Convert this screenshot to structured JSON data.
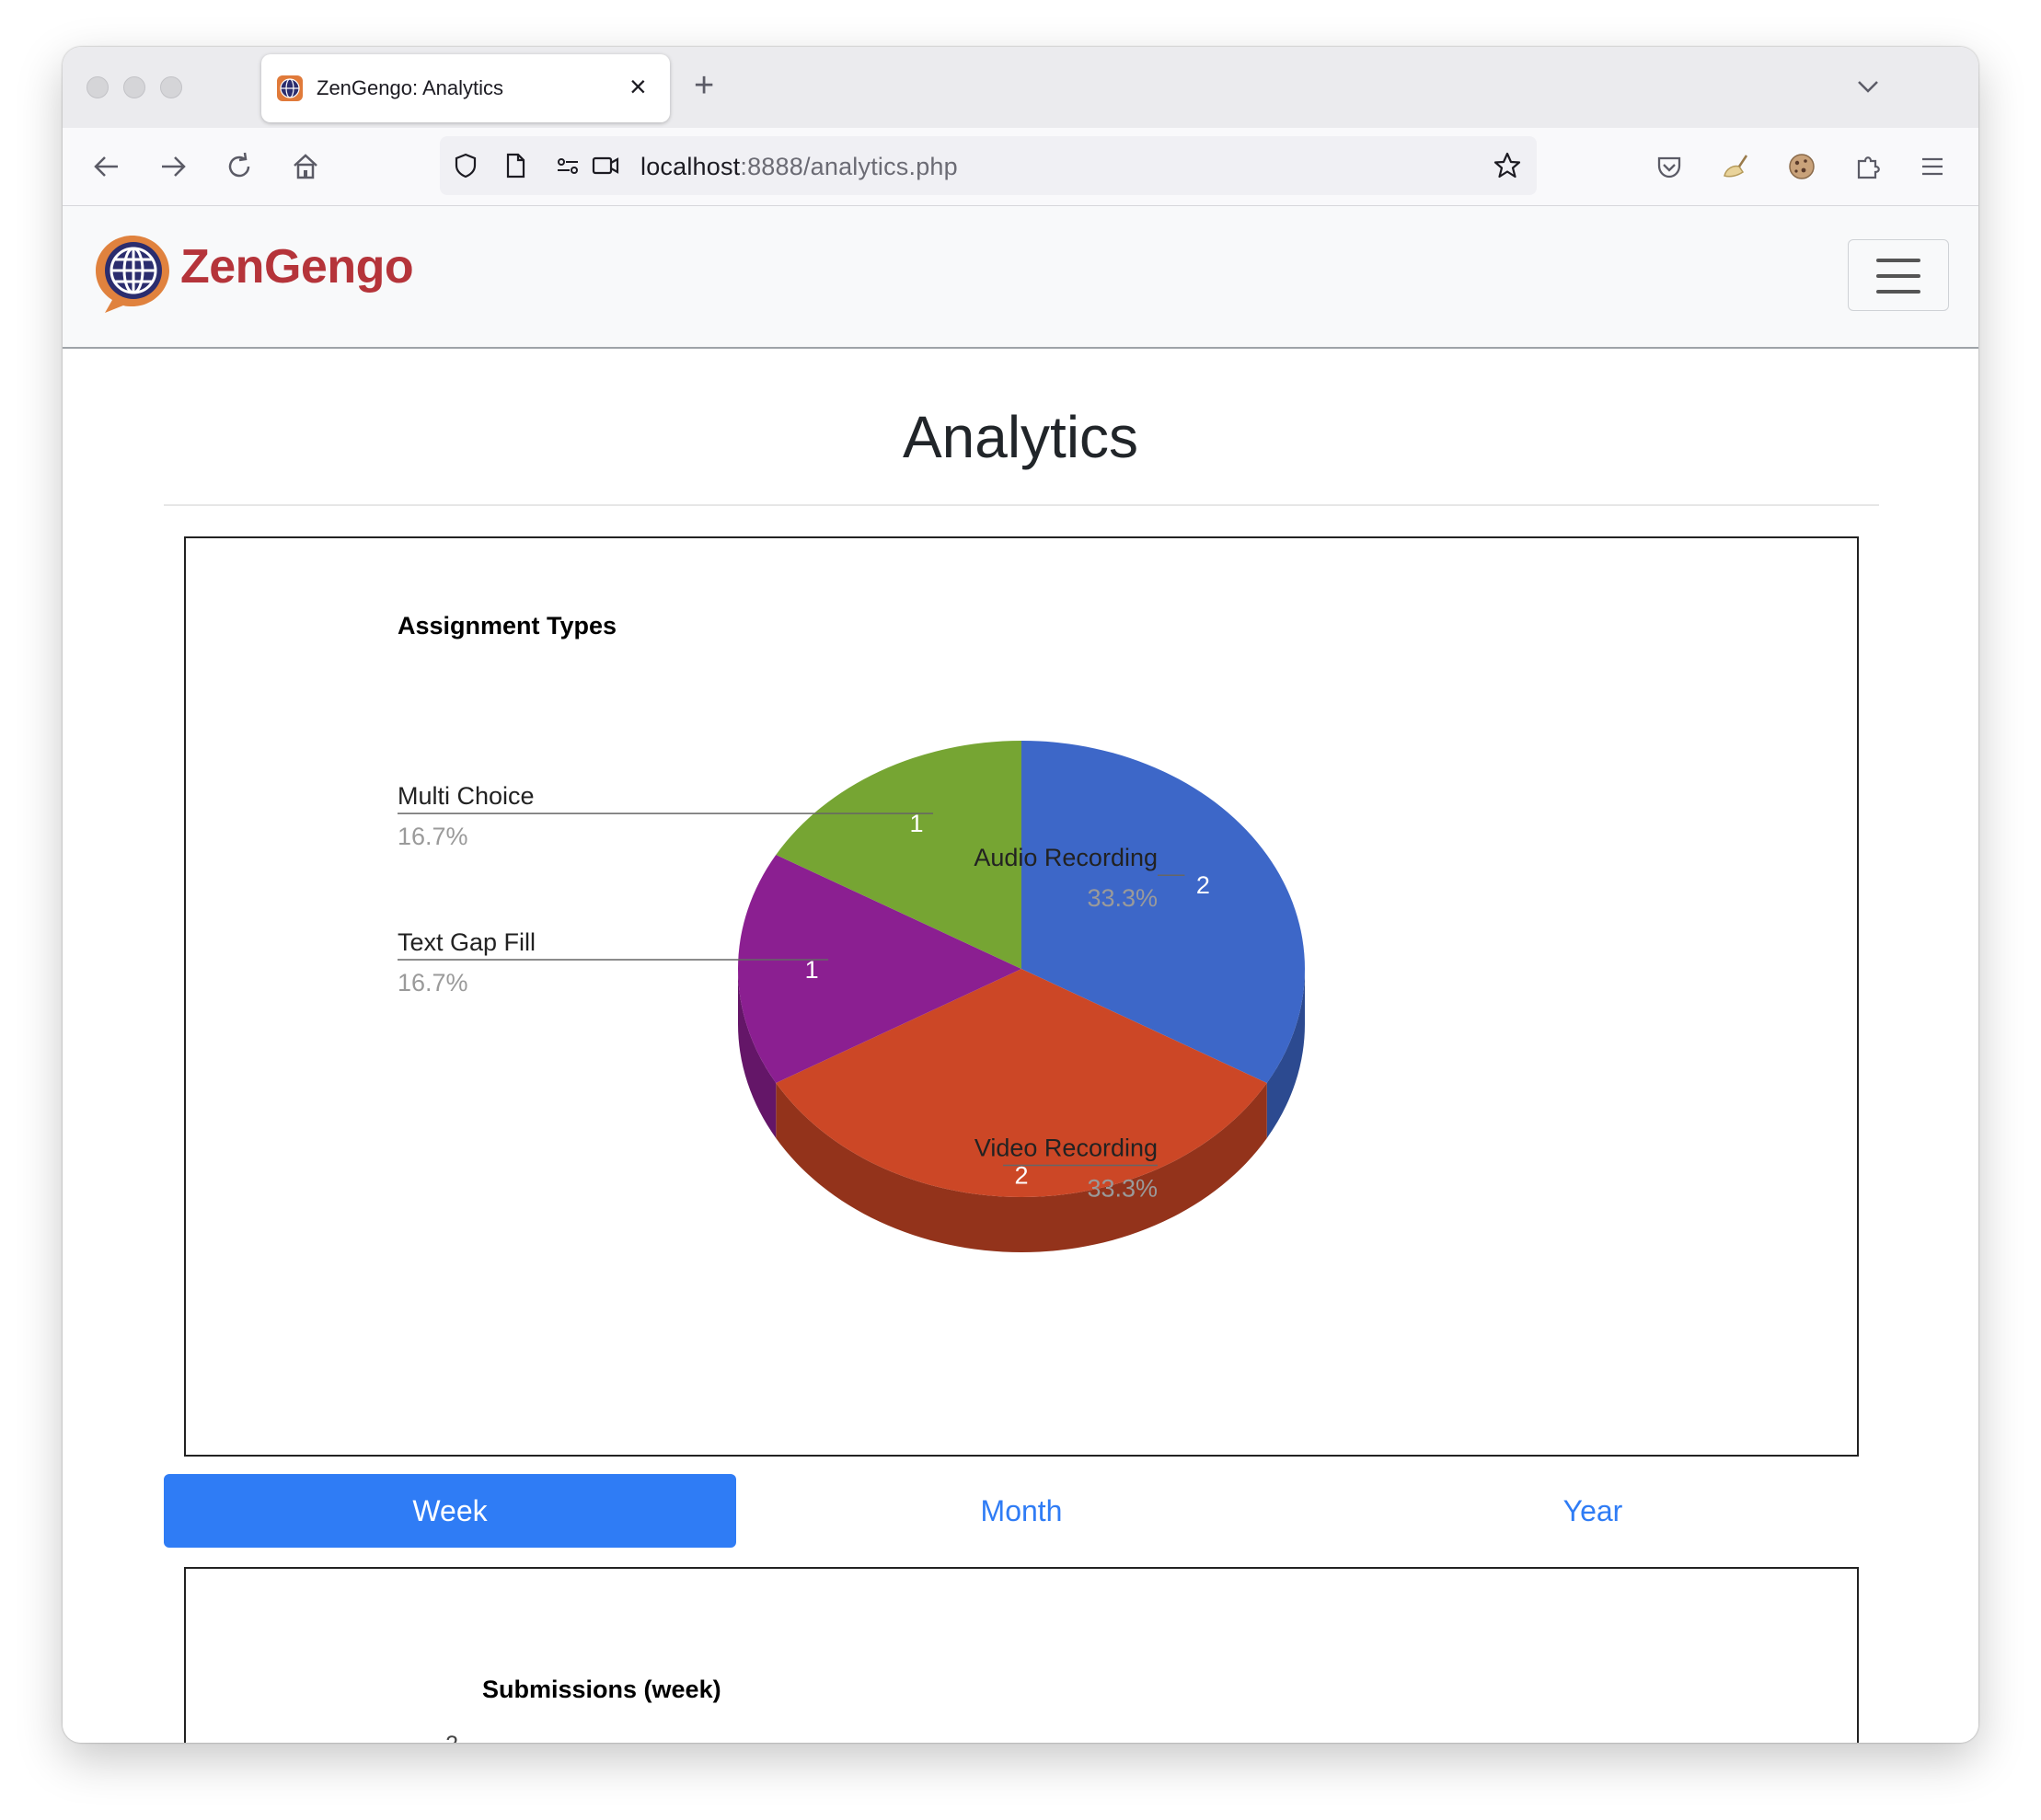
{
  "browser": {
    "tab_title": "ZenGengo: Analytics",
    "url_host": "localhost",
    "url_rest": ":8888/analytics.php"
  },
  "site": {
    "logo_text": "ZenGengo",
    "brand_color": "#b5343a"
  },
  "page": {
    "title": "Analytics"
  },
  "period_tabs": [
    {
      "label": "Week",
      "active": true
    },
    {
      "label": "Month",
      "active": false
    },
    {
      "label": "Year",
      "active": false
    }
  ],
  "chart_data": [
    {
      "type": "pie",
      "title": "Assignment Types",
      "three_d": true,
      "slices": [
        {
          "label": "Audio Recording",
          "value": 2,
          "percent": "33.3%",
          "color": "#3d67c8"
        },
        {
          "label": "Video Recording",
          "value": 2,
          "percent": "33.3%",
          "color": "#cc4726"
        },
        {
          "label": "Text Gap Fill",
          "value": 1,
          "percent": "16.7%",
          "color": "#8b1f91"
        },
        {
          "label": "Multi Choice",
          "value": 1,
          "percent": "16.7%",
          "color": "#76a533"
        }
      ]
    },
    {
      "type": "bar",
      "title": "Submissions (week)",
      "y_ticks": [
        "2"
      ],
      "series_color": "#3d67c8",
      "note": "partially visible"
    }
  ]
}
